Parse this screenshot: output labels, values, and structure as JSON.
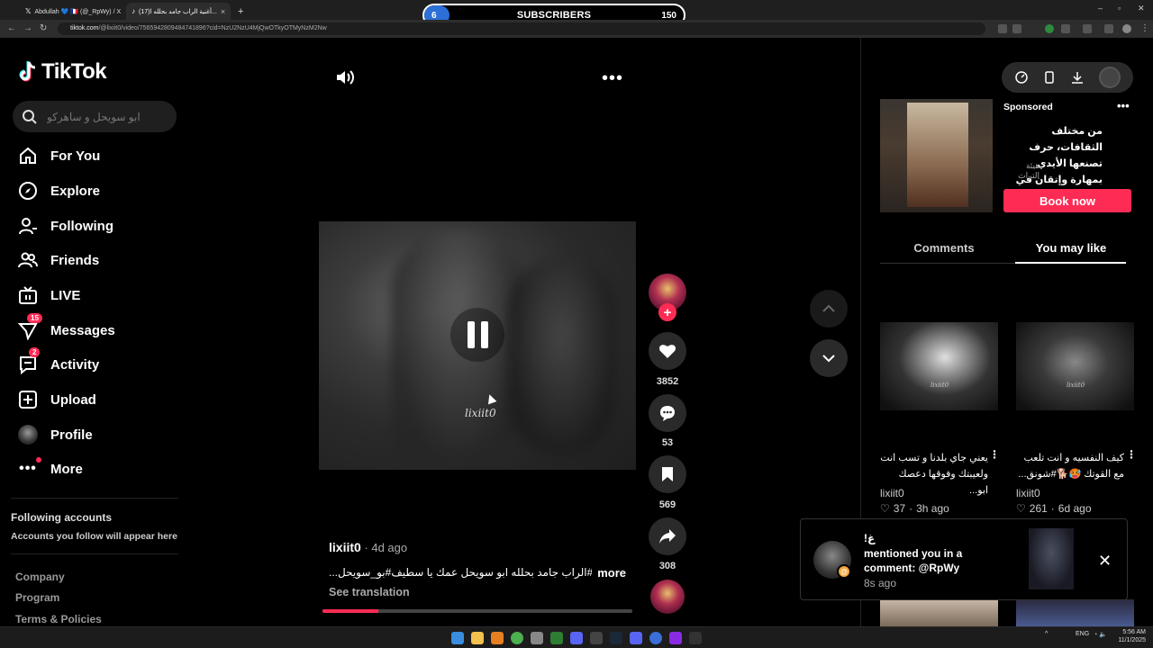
{
  "browser": {
    "tabs": [
      {
        "title": "Abdullah 💙 🇫🇷 (@_RpWy) / X"
      },
      {
        "title": "(17)أغنية الراب جامد بحلله ا..."
      }
    ],
    "url_domain": "tiktok.com",
    "url_path": "/@lixiit0/video/7565942809484741896?cid=NzU2NzU4MjQwOTkyOTMyNzM2Nw"
  },
  "overlay": {
    "current": "6",
    "label": "SUBSCRIBERS",
    "goal": "150",
    "progress_fraction": 0.04
  },
  "sidebar": {
    "logo": "TikTok",
    "search_placeholder": "ابو سويحل و ساهركو",
    "items": [
      {
        "label": "For You"
      },
      {
        "label": "Explore"
      },
      {
        "label": "Following"
      },
      {
        "label": "Friends"
      },
      {
        "label": "LIVE"
      },
      {
        "label": "Messages",
        "badge": "15"
      },
      {
        "label": "Activity",
        "badge": "2"
      },
      {
        "label": "Upload"
      },
      {
        "label": "Profile"
      },
      {
        "label": "More"
      }
    ],
    "following_title": "Following accounts",
    "following_sub": "Accounts you follow will appear here",
    "footer": [
      "Company",
      "Program",
      "Terms & Policies"
    ]
  },
  "video": {
    "watermark": "lixiit0",
    "author": "lixiit0",
    "age": " · 4d ago",
    "caption": "#الراب جامد بحلله ابو سويحل عمك يا سطيف#بو_سويحل...",
    "more": "more",
    "see_translation": "See translation",
    "progress_fraction": 0.18,
    "likes": "3852",
    "comments": "53",
    "saves": "569",
    "shares": "308"
  },
  "right": {
    "sponsored": "Sponsored",
    "ad_text": "من مختلف الثقافات، حرف تصنعها الأيدي بمهارة وإتقان في معرض...",
    "ad_brand": "هيئة التراث",
    "book_now": "Book now",
    "tab_comments": "Comments",
    "tab_you_may_like": "You may like",
    "recs": [
      {
        "title": "يعني جاي بلدنا و تسب انت ولعيبتك وفوقها دعصك ابو...",
        "author": "lixiit0",
        "likes": "37",
        "age": "3h ago"
      },
      {
        "title": "كيف النفسيه و انت تلعب مع القوتك 🥵🐕#شونق...",
        "author": "lixiit0",
        "likes": "261",
        "age": "6d ago"
      }
    ]
  },
  "notification": {
    "title": "!غ",
    "body": "mentioned you in a comment: @RpWy",
    "time": "8s ago"
  },
  "taskbar": {
    "lang": "ENG",
    "time": "5:56 AM",
    "date": "11/1/2025"
  }
}
